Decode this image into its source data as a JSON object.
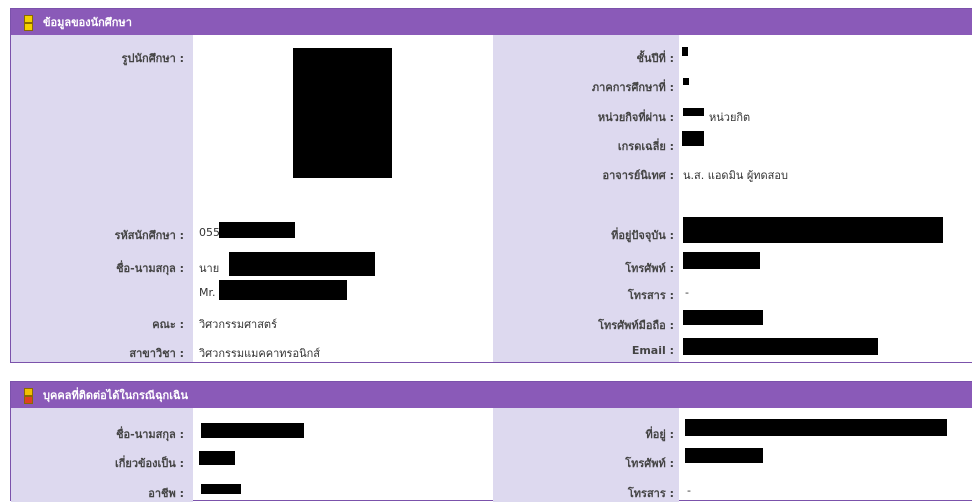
{
  "student": {
    "title": "ข้อมูลของนักศึกษา",
    "photo_label": "รูปนักศึกษา :",
    "year_label": "ชั้นปีที่ :",
    "semester_label": "ภาคการศึกษาที่ :",
    "credits_label": "หน่วยกิจที่ผ่าน :",
    "credits_unit": "หน่วยกิต",
    "gpa_label": "เกรดเฉลี่ย :",
    "advisor_label": "อาจารย์นิเทศ :",
    "advisor_value": "น.ส. แอดมิน ผู้ทดสอบ",
    "id_label": "รหัสนักศึกษา :",
    "id_prefix": "055",
    "name_label": "ชื่อ-นามสกุล :",
    "name_prefix_th": "นาย",
    "name_prefix_en": "Mr.",
    "faculty_label": "คณะ :",
    "faculty_value": "วิศวกรรมศาสตร์",
    "major_label": "สาขาวิชา :",
    "major_value": "วิศวกรรมแมคคาทรอนิกส์",
    "address_label": "ที่อยู่ปัจจุบัน :",
    "phone_label": "โทรศัพท์ :",
    "fax_label": "โทรสาร :",
    "fax_value": "-",
    "mobile_label": "โทรศัพท์มือถือ :",
    "email_label": "Email :"
  },
  "emergency": {
    "title": "บุคคลที่ติดต่อได้ในกรณีฉุกเฉิน",
    "name_label": "ชื่อ-นามสกุล :",
    "relation_label": "เกี่ยวข้องเป็น :",
    "occupation_label": "อาชีพ :",
    "address_label": "ที่อยู่ :",
    "phone_label": "โทรศัพท์ :",
    "fax_label": "โทรสาร :",
    "fax_value": "-"
  }
}
